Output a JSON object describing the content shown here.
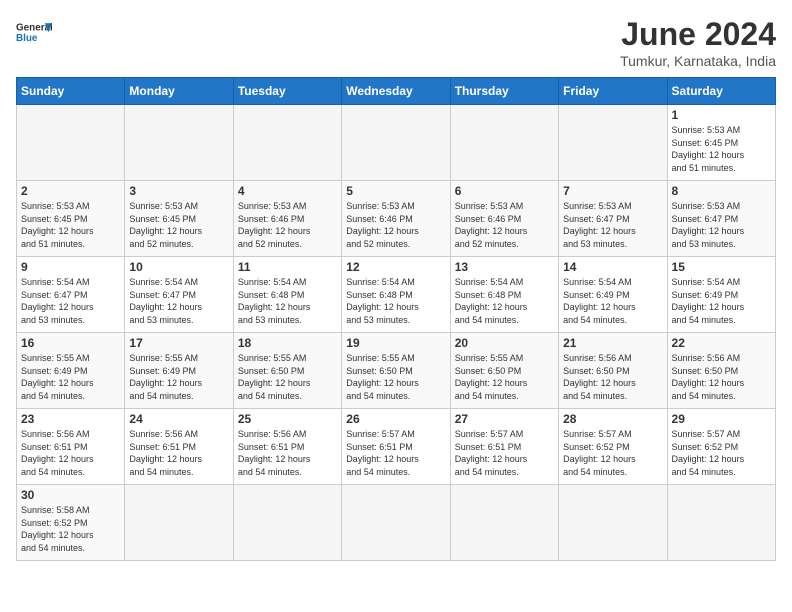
{
  "header": {
    "logo_general": "General",
    "logo_blue": "Blue",
    "month_title": "June 2024",
    "location": "Tumkur, Karnataka, India"
  },
  "weekdays": [
    "Sunday",
    "Monday",
    "Tuesday",
    "Wednesday",
    "Thursday",
    "Friday",
    "Saturday"
  ],
  "weeks": [
    [
      {
        "day": "",
        "info": ""
      },
      {
        "day": "",
        "info": ""
      },
      {
        "day": "",
        "info": ""
      },
      {
        "day": "",
        "info": ""
      },
      {
        "day": "",
        "info": ""
      },
      {
        "day": "",
        "info": ""
      },
      {
        "day": "1",
        "info": "Sunrise: 5:53 AM\nSunset: 6:45 PM\nDaylight: 12 hours\nand 51 minutes."
      }
    ],
    [
      {
        "day": "2",
        "info": "Sunrise: 5:53 AM\nSunset: 6:45 PM\nDaylight: 12 hours\nand 51 minutes."
      },
      {
        "day": "3",
        "info": "Sunrise: 5:53 AM\nSunset: 6:45 PM\nDaylight: 12 hours\nand 52 minutes."
      },
      {
        "day": "4",
        "info": "Sunrise: 5:53 AM\nSunset: 6:46 PM\nDaylight: 12 hours\nand 52 minutes."
      },
      {
        "day": "5",
        "info": "Sunrise: 5:53 AM\nSunset: 6:46 PM\nDaylight: 12 hours\nand 52 minutes."
      },
      {
        "day": "6",
        "info": "Sunrise: 5:53 AM\nSunset: 6:46 PM\nDaylight: 12 hours\nand 52 minutes."
      },
      {
        "day": "7",
        "info": "Sunrise: 5:53 AM\nSunset: 6:47 PM\nDaylight: 12 hours\nand 53 minutes."
      },
      {
        "day": "8",
        "info": "Sunrise: 5:53 AM\nSunset: 6:47 PM\nDaylight: 12 hours\nand 53 minutes."
      }
    ],
    [
      {
        "day": "9",
        "info": "Sunrise: 5:54 AM\nSunset: 6:47 PM\nDaylight: 12 hours\nand 53 minutes."
      },
      {
        "day": "10",
        "info": "Sunrise: 5:54 AM\nSunset: 6:47 PM\nDaylight: 12 hours\nand 53 minutes."
      },
      {
        "day": "11",
        "info": "Sunrise: 5:54 AM\nSunset: 6:48 PM\nDaylight: 12 hours\nand 53 minutes."
      },
      {
        "day": "12",
        "info": "Sunrise: 5:54 AM\nSunset: 6:48 PM\nDaylight: 12 hours\nand 53 minutes."
      },
      {
        "day": "13",
        "info": "Sunrise: 5:54 AM\nSunset: 6:48 PM\nDaylight: 12 hours\nand 54 minutes."
      },
      {
        "day": "14",
        "info": "Sunrise: 5:54 AM\nSunset: 6:49 PM\nDaylight: 12 hours\nand 54 minutes."
      },
      {
        "day": "15",
        "info": "Sunrise: 5:54 AM\nSunset: 6:49 PM\nDaylight: 12 hours\nand 54 minutes."
      }
    ],
    [
      {
        "day": "16",
        "info": "Sunrise: 5:55 AM\nSunset: 6:49 PM\nDaylight: 12 hours\nand 54 minutes."
      },
      {
        "day": "17",
        "info": "Sunrise: 5:55 AM\nSunset: 6:49 PM\nDaylight: 12 hours\nand 54 minutes."
      },
      {
        "day": "18",
        "info": "Sunrise: 5:55 AM\nSunset: 6:50 PM\nDaylight: 12 hours\nand 54 minutes."
      },
      {
        "day": "19",
        "info": "Sunrise: 5:55 AM\nSunset: 6:50 PM\nDaylight: 12 hours\nand 54 minutes."
      },
      {
        "day": "20",
        "info": "Sunrise: 5:55 AM\nSunset: 6:50 PM\nDaylight: 12 hours\nand 54 minutes."
      },
      {
        "day": "21",
        "info": "Sunrise: 5:56 AM\nSunset: 6:50 PM\nDaylight: 12 hours\nand 54 minutes."
      },
      {
        "day": "22",
        "info": "Sunrise: 5:56 AM\nSunset: 6:50 PM\nDaylight: 12 hours\nand 54 minutes."
      }
    ],
    [
      {
        "day": "23",
        "info": "Sunrise: 5:56 AM\nSunset: 6:51 PM\nDaylight: 12 hours\nand 54 minutes."
      },
      {
        "day": "24",
        "info": "Sunrise: 5:56 AM\nSunset: 6:51 PM\nDaylight: 12 hours\nand 54 minutes."
      },
      {
        "day": "25",
        "info": "Sunrise: 5:56 AM\nSunset: 6:51 PM\nDaylight: 12 hours\nand 54 minutes."
      },
      {
        "day": "26",
        "info": "Sunrise: 5:57 AM\nSunset: 6:51 PM\nDaylight: 12 hours\nand 54 minutes."
      },
      {
        "day": "27",
        "info": "Sunrise: 5:57 AM\nSunset: 6:51 PM\nDaylight: 12 hours\nand 54 minutes."
      },
      {
        "day": "28",
        "info": "Sunrise: 5:57 AM\nSunset: 6:52 PM\nDaylight: 12 hours\nand 54 minutes."
      },
      {
        "day": "29",
        "info": "Sunrise: 5:57 AM\nSunset: 6:52 PM\nDaylight: 12 hours\nand 54 minutes."
      }
    ],
    [
      {
        "day": "30",
        "info": "Sunrise: 5:58 AM\nSunset: 6:52 PM\nDaylight: 12 hours\nand 54 minutes."
      },
      {
        "day": "",
        "info": ""
      },
      {
        "day": "",
        "info": ""
      },
      {
        "day": "",
        "info": ""
      },
      {
        "day": "",
        "info": ""
      },
      {
        "day": "",
        "info": ""
      },
      {
        "day": "",
        "info": ""
      }
    ]
  ]
}
